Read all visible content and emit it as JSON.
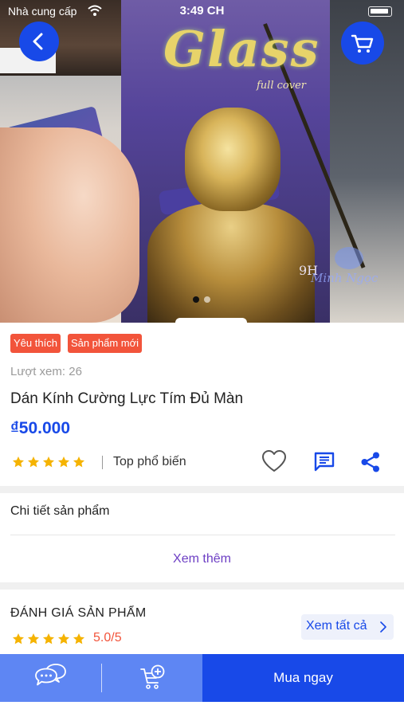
{
  "status_bar": {
    "carrier": "Nhà cung cấp",
    "time": "3:49 CH"
  },
  "hero": {
    "product_box_brand": "Glass",
    "product_box_subtitle": "full cover",
    "product_box_hardness": "9H",
    "watermark": "Minh Ngọc",
    "image_count": 2,
    "active_image": 1
  },
  "badges": [
    "Yêu thích",
    "Sản phẩm mới"
  ],
  "product": {
    "views": "Lượt xem: 26",
    "title": "Dán Kính Cường Lực Tím Đủ Màn",
    "price": "₫50.000",
    "rating_stars": 5,
    "popular_label": "Top phổ biến"
  },
  "details": {
    "title": "Chi tiết sản phẩm",
    "see_more": "Xem thêm"
  },
  "reviews": {
    "title": "ĐÁNH GIÁ SẢN PHẨM",
    "stars": 5,
    "score": "5.0/5",
    "see_all": "Xem tất cả"
  },
  "bottom_bar": {
    "buy_now": "Mua ngay"
  },
  "colors": {
    "primary": "#1849e8",
    "secondary_bar": "#5e86f3",
    "badge": "#f2543b",
    "star": "#f5b301",
    "see_more": "#6d3fc4"
  },
  "icons": [
    "chevron-left-icon",
    "cart-icon",
    "wifi-icon",
    "battery-icon",
    "star-icon",
    "heart-icon",
    "comment-icon",
    "share-icon",
    "chevron-right-icon",
    "chat-icon",
    "add-to-cart-icon"
  ]
}
